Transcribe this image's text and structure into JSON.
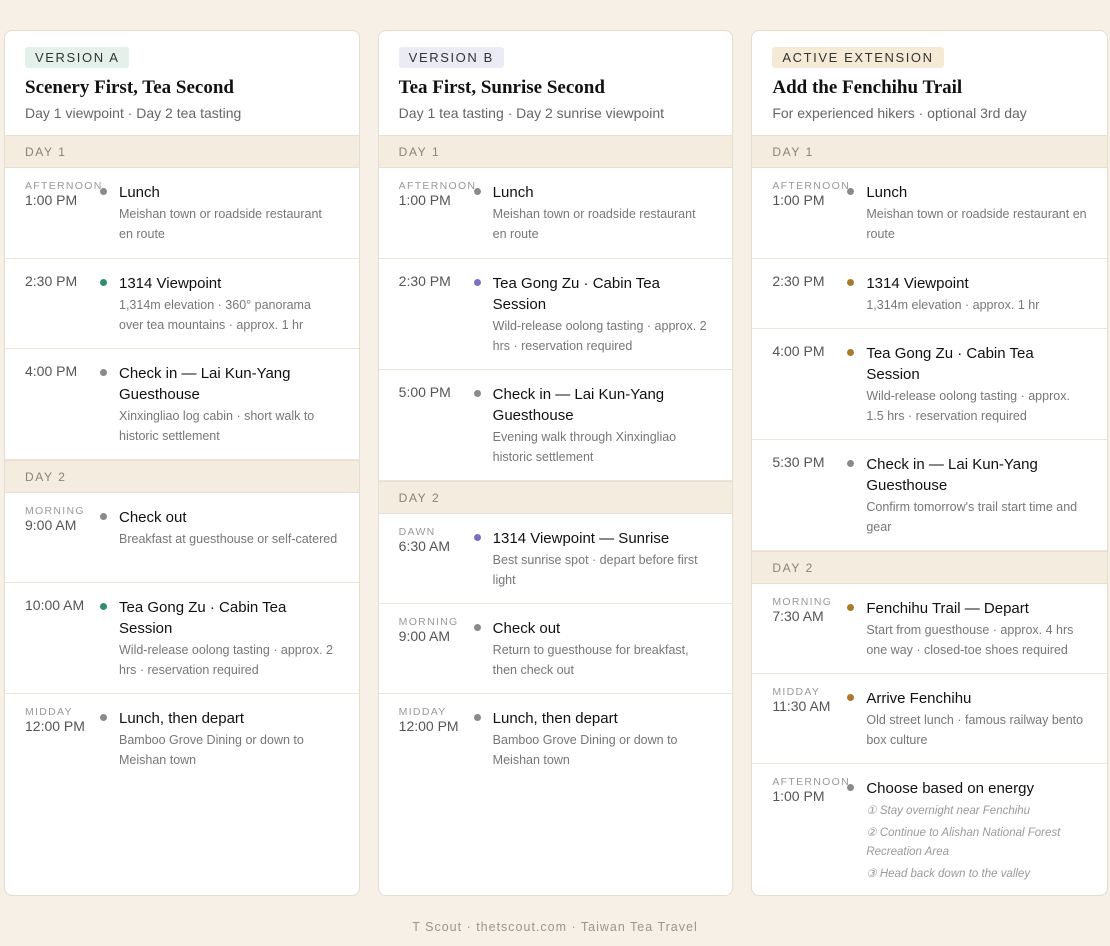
{
  "colors": {
    "green": "#2f8f6b",
    "purple": "#7c6ec4",
    "amber": "#a77a2c",
    "gray": "#8a8a8a",
    "badge_a": "#e3f1ea",
    "badge_b": "#ebebf6",
    "badge_c": "#f5ead6"
  },
  "columns": [
    {
      "badge": "VERSION A",
      "title": "Scenery First, Tea Second",
      "subtitle": "Day 1 viewpoint · Day 2 tea tasting",
      "days": [
        {
          "label": "DAY 1",
          "events": [
            {
              "period": "AFTERNOON",
              "time": "1:00 PM",
              "title": "Lunch",
              "desc": "Meishan town or roadside restaurant en route",
              "dot": "gray"
            },
            {
              "period": "",
              "time": "2:30 PM",
              "title": "1314 Viewpoint",
              "desc": "1,314m elevation · 360° panorama over tea mountains · approx. 1 hr",
              "dot": "green"
            },
            {
              "period": "",
              "time": "4:00 PM",
              "title": "Check in — Lai Kun-Yang Guesthouse",
              "desc": "Xinxingliao log cabin · short walk to historic settlement",
              "dot": "gray"
            }
          ]
        },
        {
          "label": "DAY 2",
          "events": [
            {
              "period": "MORNING",
              "time": "9:00 AM",
              "title": "Check out",
              "desc": "Breakfast at guesthouse or self-catered",
              "dot": "gray"
            },
            {
              "period": "",
              "time": "10:00 AM",
              "title": "Tea Gong Zu · Cabin Tea Session",
              "desc": "Wild-release oolong tasting · approx. 2 hrs · reservation required",
              "dot": "green"
            },
            {
              "period": "MIDDAY",
              "time": "12:00 PM",
              "title": "Lunch, then depart",
              "desc": "Bamboo Grove Dining or down to Meishan town",
              "dot": "gray"
            }
          ]
        }
      ]
    },
    {
      "badge": "VERSION B",
      "title": "Tea First, Sunrise Second",
      "subtitle": "Day 1 tea tasting · Day 2 sunrise viewpoint",
      "days": [
        {
          "label": "DAY 1",
          "events": [
            {
              "period": "AFTERNOON",
              "time": "1:00 PM",
              "title": "Lunch",
              "desc": "Meishan town or roadside restaurant en route",
              "dot": "gray"
            },
            {
              "period": "",
              "time": "2:30 PM",
              "title": "Tea Gong Zu · Cabin Tea Session",
              "desc": "Wild-release oolong tasting · approx. 2 hrs · reservation required",
              "dot": "purple"
            },
            {
              "period": "",
              "time": "5:00 PM",
              "title": "Check in — Lai Kun-Yang Guesthouse",
              "desc": "Evening walk through Xinxingliao historic settlement",
              "dot": "gray"
            }
          ]
        },
        {
          "label": "DAY 2",
          "events": [
            {
              "period": "DAWN",
              "time": "6:30 AM",
              "title": "1314 Viewpoint — Sunrise",
              "desc": "Best sunrise spot · depart before first light",
              "dot": "purple"
            },
            {
              "period": "MORNING",
              "time": "9:00 AM",
              "title": "Check out",
              "desc": "Return to guesthouse for breakfast, then check out",
              "dot": "gray"
            },
            {
              "period": "MIDDAY",
              "time": "12:00 PM",
              "title": "Lunch, then depart",
              "desc": "Bamboo Grove Dining or down to Meishan town",
              "dot": "gray"
            }
          ]
        }
      ]
    },
    {
      "badge": "ACTIVE EXTENSION",
      "title": "Add the Fenchihu Trail",
      "subtitle": "For experienced hikers · optional 3rd day",
      "days": [
        {
          "label": "DAY 1",
          "events": [
            {
              "period": "AFTERNOON",
              "time": "1:00 PM",
              "title": "Lunch",
              "desc": "Meishan town or roadside restaurant en route",
              "dot": "gray"
            },
            {
              "period": "",
              "time": "2:30 PM",
              "title": "1314 Viewpoint",
              "desc": "1,314m elevation · approx. 1 hr",
              "dot": "amber"
            },
            {
              "period": "",
              "time": "4:00 PM",
              "title": "Tea Gong Zu · Cabin Tea Session",
              "desc": "Wild-release oolong tasting · approx. 1.5 hrs · reservation required",
              "dot": "amber"
            },
            {
              "period": "",
              "time": "5:30 PM",
              "title": "Check in — Lai Kun-Yang Guesthouse",
              "desc": "Confirm tomorrow's trail start time and gear",
              "dot": "gray"
            }
          ]
        },
        {
          "label": "DAY 2",
          "events": [
            {
              "period": "MORNING",
              "time": "7:30 AM",
              "title": "Fenchihu Trail — Depart",
              "desc": "Start from guesthouse · approx. 4 hrs one way · closed-toe shoes required",
              "dot": "amber"
            },
            {
              "period": "MIDDAY",
              "time": "11:30 AM",
              "title": "Arrive Fenchihu",
              "desc": "Old street lunch · famous railway bento box culture",
              "dot": "amber"
            },
            {
              "period": "AFTERNOON",
              "time": "1:00 PM",
              "title": "Choose based on energy",
              "desc": "",
              "dot": "gray",
              "options": [
                "① Stay overnight near Fenchihu",
                "② Continue to Alishan National Forest Recreation Area",
                "③ Head back down to the valley"
              ]
            }
          ]
        }
      ]
    }
  ],
  "footer": "T Scout · thetscout.com · Taiwan Tea Travel"
}
